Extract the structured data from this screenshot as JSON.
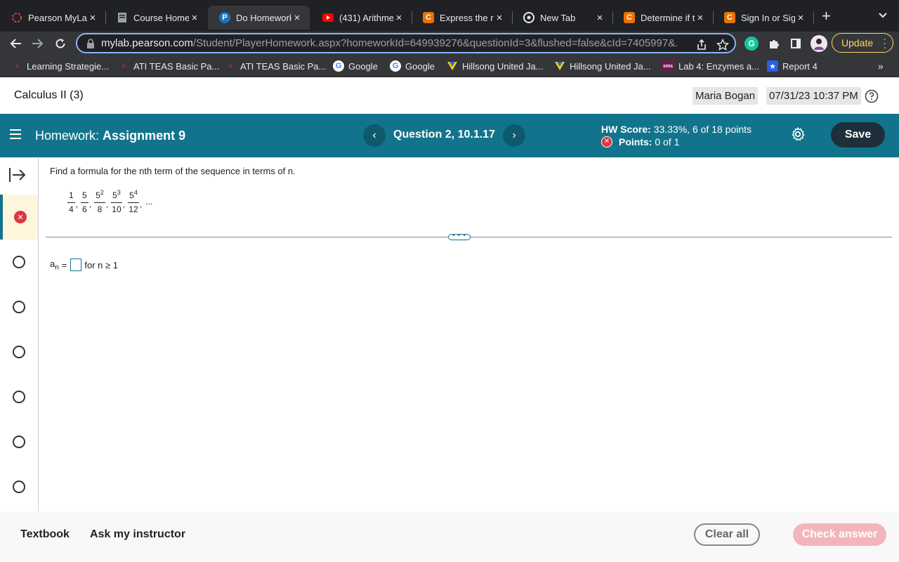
{
  "browser": {
    "tabs": [
      {
        "title": "Pearson MyLa",
        "icon": "pearson-ring-icon"
      },
      {
        "title": "Course Home",
        "icon": "document-icon"
      },
      {
        "title": "Do Homework",
        "icon": "pearson-p-icon",
        "active": true
      },
      {
        "title": "(431) Arithme",
        "icon": "youtube-icon"
      },
      {
        "title": "Express the re",
        "icon": "chegg-icon"
      },
      {
        "title": "New Tab",
        "icon": "chrome-icon"
      },
      {
        "title": "Determine if th",
        "icon": "chegg-icon"
      },
      {
        "title": "Sign In or Sign",
        "icon": "chegg-icon"
      }
    ],
    "url_host": "mylab.pearson.com",
    "url_path": "/Student/PlayerHomework.aspx?homeworkId=649939276&questionId=3&flushed=false&cId=7405997&...",
    "update_label": "Update",
    "bookmarks": [
      {
        "label": "Learning Strategie..."
      },
      {
        "label": "ATI TEAS Basic Pa..."
      },
      {
        "label": "ATI TEAS Basic Pa..."
      },
      {
        "label": "Google"
      },
      {
        "label": "Google"
      },
      {
        "label": "Hillsong United Ja..."
      },
      {
        "label": "Hillsong United Ja..."
      },
      {
        "label": "Lab 4: Enzymes a..."
      },
      {
        "label": "Report 4"
      }
    ],
    "bookmarks_more": "»"
  },
  "course": {
    "title": "Calculus II (3)",
    "user": "Maria Bogan",
    "datetime": "07/31/23 10:37 PM"
  },
  "homework": {
    "label": "Homework:",
    "name": "Assignment 9",
    "question_label": "Question 2, 10.1.17",
    "score_label": "HW Score:",
    "score_value": "33.33%, 6 of 18 points",
    "points_label": "Points:",
    "points_value": "0 of 1",
    "save_label": "Save"
  },
  "question": {
    "prompt": "Find a formula for the nth term of the sequence in terms of n.",
    "sequence": [
      {
        "num": "1",
        "exp": "",
        "den": "4"
      },
      {
        "num": "5",
        "exp": "",
        "den": "6"
      },
      {
        "num": "5",
        "exp": "2",
        "den": "8"
      },
      {
        "num": "5",
        "exp": "3",
        "den": "10"
      },
      {
        "num": "5",
        "exp": "4",
        "den": "12"
      }
    ],
    "ellipsis": "...",
    "answer_lhs": "a",
    "answer_sub": "n",
    "answer_eq": "=",
    "answer_suffix": "for n ≥ 1"
  },
  "rail": {
    "items": [
      "unanswered",
      "incorrect",
      "unanswered",
      "unanswered",
      "unanswered",
      "unanswered",
      "unanswered",
      "unanswered"
    ]
  },
  "footer": {
    "textbook": "Textbook",
    "ask": "Ask my instructor",
    "clear": "Clear all",
    "check": "Check answer"
  },
  "colors": {
    "header_teal": "#12748c",
    "incorrect_red": "#d9373f",
    "check_disabled": "#f3b5bc",
    "save_dark": "#1d2f3a"
  }
}
